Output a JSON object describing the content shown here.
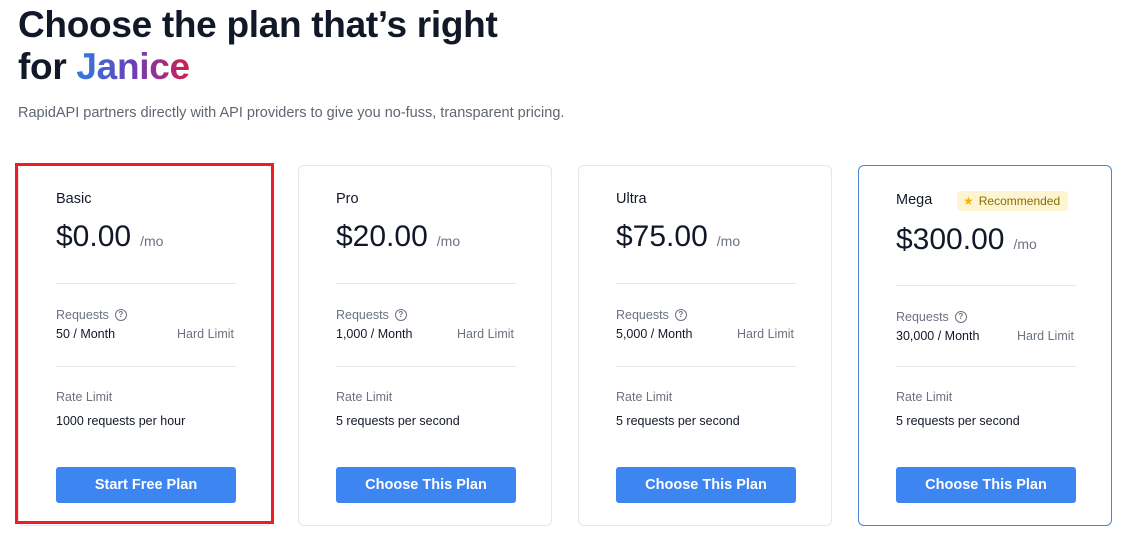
{
  "header": {
    "title_line1": "Choose the plan that’s right",
    "title_for": "for ",
    "title_name": "Janice",
    "subtitle": "RapidAPI partners directly with API providers to give you no-fuss, transparent pricing."
  },
  "labels": {
    "per_month": "/mo",
    "requests": "Requests",
    "hard_limit": "Hard Limit",
    "rate_limit": "Rate Limit",
    "help_glyph": "?",
    "star_glyph": "★"
  },
  "plans": [
    {
      "name": "Basic",
      "price": "$0.00",
      "requests": "50 / Month",
      "rate": "1000 requests per hour",
      "button": "Start Free Plan"
    },
    {
      "name": "Pro",
      "price": "$20.00",
      "requests": "1,000 / Month",
      "rate": "5 requests per second",
      "button": "Choose This Plan"
    },
    {
      "name": "Ultra",
      "price": "$75.00",
      "requests": "5,000 / Month",
      "rate": "5 requests per second",
      "button": "Choose This Plan"
    },
    {
      "name": "Mega",
      "price": "$300.00",
      "requests": "30,000 / Month",
      "rate": "5 requests per second",
      "button": "Choose This Plan",
      "badge": "Recommended"
    }
  ],
  "colors": {
    "button": "#3d86f2",
    "selection_outline": "#ee1d24",
    "recommended_border": "#4a86d0",
    "badge_bg": "#fdf5d2",
    "star": "#f5b400"
  }
}
